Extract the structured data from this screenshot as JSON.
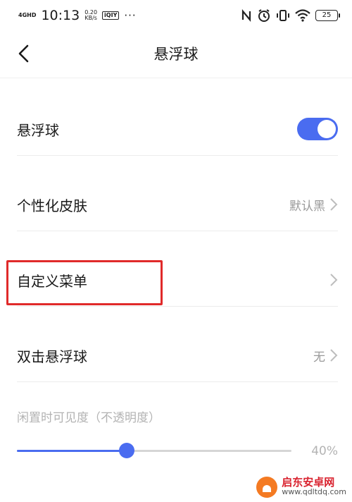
{
  "status_bar": {
    "network": "4GHD",
    "time": "10:13",
    "speed_value": "0.20",
    "speed_unit": "KB/s",
    "app_badge": "iQIY",
    "more": "···",
    "icons": [
      "nfc-icon",
      "alarm-icon",
      "vibrate-icon",
      "wifi-icon"
    ],
    "battery": "25"
  },
  "header": {
    "title": "悬浮球",
    "back_icon": "chevron-left-icon"
  },
  "settings": {
    "float_ball": {
      "label": "悬浮球",
      "toggle_on": true
    },
    "skin": {
      "label": "个性化皮肤",
      "value": "默认黑"
    },
    "custom_menu": {
      "label": "自定义菜单",
      "value": ""
    },
    "double_tap": {
      "label": "双击悬浮球",
      "value": "无"
    }
  },
  "idle_visibility": {
    "label": "闲置时可见度（不透明度）",
    "value_percent": 40,
    "value_text": "40%"
  },
  "watermark": {
    "title": "启东安卓网",
    "url": "www.qdltdq.com"
  },
  "colors": {
    "accent": "#4a6cf0",
    "highlight": "#e02a2a",
    "muted_text": "#9a9a9a"
  }
}
